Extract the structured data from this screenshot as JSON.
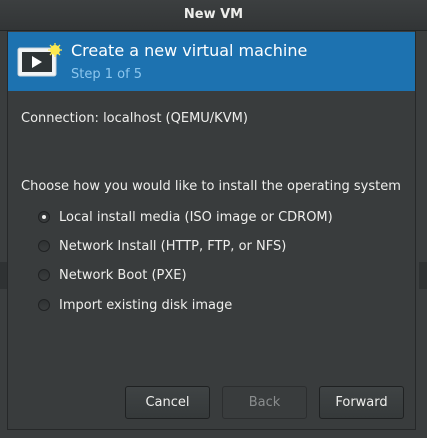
{
  "window": {
    "title": "New VM"
  },
  "banner": {
    "heading": "Create a new virtual machine",
    "step": "Step 1 of 5",
    "icon": "vm-screen-icon",
    "background_color": "#1d72b0"
  },
  "connection": {
    "text": "Connection:  localhost (QEMU/KVM)"
  },
  "install": {
    "prompt": "Choose how you would like to install the operating system",
    "options": [
      {
        "label": "Local install media (ISO image or CDROM)",
        "selected": true
      },
      {
        "label": "Network Install (HTTP, FTP, or NFS)",
        "selected": false
      },
      {
        "label": "Network Boot (PXE)",
        "selected": false
      },
      {
        "label": "Import existing disk image",
        "selected": false
      }
    ]
  },
  "buttons": {
    "cancel": "Cancel",
    "back": "Back",
    "forward": "Forward",
    "back_enabled": false
  }
}
